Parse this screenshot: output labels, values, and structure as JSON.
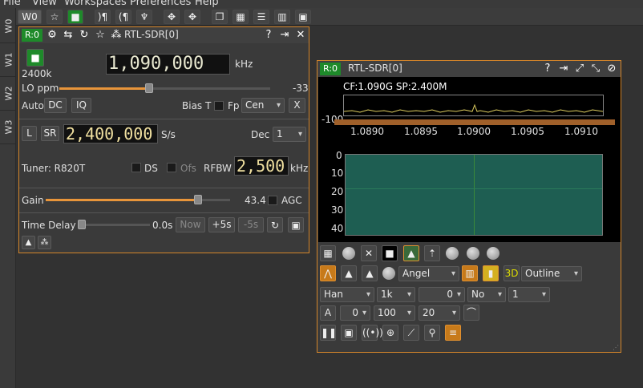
{
  "menu": [
    "File",
    "View",
    "Workspaces",
    "Preferences",
    "Help"
  ],
  "sidetabs": [
    "W0",
    "W1",
    "W2",
    "W3"
  ],
  "toolbar": {
    "workspace_label": "W0"
  },
  "device_window": {
    "badge": "R:0",
    "title": "RTL-SDR[0]",
    "sample_rate_label": "2400k",
    "frequency": "1,090,000",
    "freq_unit": "kHz",
    "lo_ppm_label": "LO ppm",
    "lo_ppm_value": "-33",
    "auto_label": "Auto",
    "dc_label": "DC",
    "iq_label": "IQ",
    "bias_t_label": "Bias T",
    "fp_label": "Fp",
    "cen_value": "Cen",
    "x_label": "X",
    "l_label": "L",
    "sr_label": "SR",
    "sr_value": "2,400,000",
    "sr_unit": "S/s",
    "dec_label": "Dec",
    "dec_value": "1",
    "tuner_label": "Tuner: R820T",
    "ds_label": "DS",
    "ofs_label": "Ofs",
    "rfbw_label": "RFBW",
    "rfbw_value": "2,500",
    "rfbw_unit": "kHz",
    "gain_label": "Gain",
    "gain_value": "43.4",
    "agc_label": "AGC",
    "time_delay_label": "Time Delay",
    "time_delay_value": "0.0s",
    "now_label": "Now",
    "plus5_label": "+5s",
    "minus5_label": "-5s"
  },
  "spectrum_window": {
    "badge": "R:0",
    "title": "RTL-SDR[0]",
    "info": "CF:1.090G SP:2.400M",
    "y_label": "-100",
    "x_ticks": [
      "1.0890",
      "1.0895",
      "1.0900",
      "1.0905",
      "1.0910"
    ],
    "wf_ticks": [
      "0",
      "10",
      "20",
      "30",
      "40"
    ],
    "palette": "Angel",
    "outline": "Outline",
    "window_fn": "Han",
    "fft_size": "1k",
    "overlap": "0",
    "no_label": "No",
    "one_label": "1",
    "a_label": "A",
    "ref_value": "0",
    "range_value": "100",
    "avg_value": "20"
  }
}
